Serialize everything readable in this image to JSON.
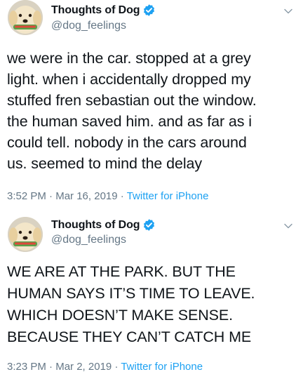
{
  "tweets": [
    {
      "display_name": "Thoughts of Dog",
      "handle": "@dog_feelings",
      "text": "we were in the car. stopped at a grey\nlight. when i accidentally dropped my\nstuffed fren sebastian out the window.\nthe human saved him. and as far as i\ncould tell. nobody in the cars around\nus. seemed to mind the delay",
      "time": "3:52 PM",
      "date": "Mar 16, 2019",
      "separator": "·",
      "source": "Twitter for iPhone"
    },
    {
      "display_name": "Thoughts of Dog",
      "handle": "@dog_feelings",
      "text": "WE ARE AT THE PARK. BUT THE\nHUMAN SAYS IT’S TIME TO LEAVE.\nWHICH DOESN’T MAKE SENSE.\nBECAUSE THEY CAN’T CATCH ME",
      "time": "3:23 PM",
      "date": "Mar 2, 2019",
      "separator": "·",
      "source": "Twitter for iPhone"
    }
  ],
  "icons": {
    "avatar": "dog-avatar-icon",
    "verified": "verified-badge-icon",
    "menu": "chevron-down-icon"
  },
  "colors": {
    "text": "#0f1419",
    "secondary": "#657786",
    "link": "#1da1f2",
    "verified": "#1da1f2"
  }
}
